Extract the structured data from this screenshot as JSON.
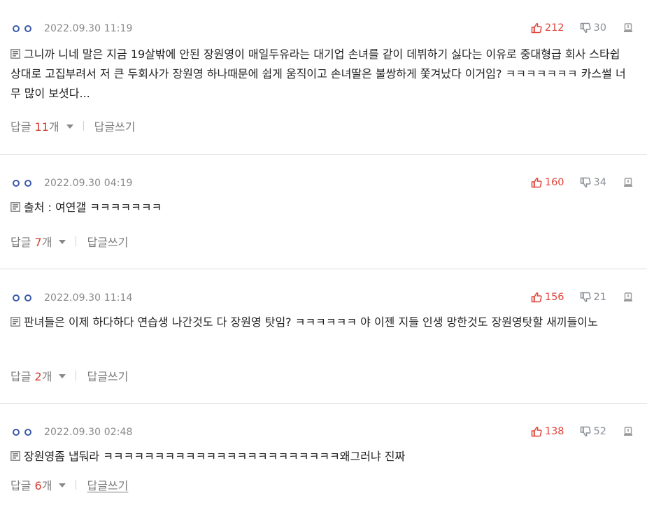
{
  "comments": [
    {
      "date": "2022.09.30 11:19",
      "upvotes": "212",
      "downvotes": "30",
      "text": "그니까 니네 말은 지금 19살밖에 안된 장원영이 매일두유라는 대기업 손녀를 같이 데뷔하기 싫다는 이유로 중대형급 회사 스타쉽 상대로 고집부려서 저 큰 두회사가 장원영 하나때문에 쉽게 움직이고 손녀딸은 불쌍하게 쫓겨났다 이거임? ㅋㅋㅋㅋㅋㅋㅋ 카스썰 너무 많이 보셧다...",
      "reply_label": "답글",
      "reply_count": "11",
      "reply_unit": "개",
      "write_label": "답글쓰기"
    },
    {
      "date": "2022.09.30 04:19",
      "upvotes": "160",
      "downvotes": "34",
      "text": "출처 : 여연갤 ㅋㅋㅋㅋㅋㅋㅋ",
      "reply_label": "답글",
      "reply_count": "7",
      "reply_unit": "개",
      "write_label": "답글쓰기"
    },
    {
      "date": "2022.09.30 11:14",
      "upvotes": "156",
      "downvotes": "21",
      "text": "판녀들은 이제 하다하다 연습생 나간것도 다 장원영 탓임? ㅋㅋㅋㅋㅋㅋ 야 이젠 지들 인생 망한것도 장원영탓할 새끼들이노",
      "reply_label": "답글",
      "reply_count": "2",
      "reply_unit": "개",
      "write_label": "답글쓰기"
    },
    {
      "date": "2022.09.30 02:48",
      "upvotes": "138",
      "downvotes": "52",
      "text": "장원영좀 냅둬라 ㅋㅋㅋㅋㅋㅋㅋㅋㅋㅋㅋㅋㅋㅋㅋㅋㅋㅋㅋㅋㅋㅋㅋ왜그러냐 진짜",
      "reply_label": "답글",
      "reply_count": "6",
      "reply_unit": "개",
      "write_label": "답글쓰기"
    }
  ],
  "icons": {
    "user": "user-dots-icon",
    "upvote": "thumbs-up-icon",
    "downvote": "thumbs-down-icon",
    "report": "report-icon",
    "memo": "memo-icon",
    "expand": "chevron-down-icon"
  },
  "colors": {
    "accent_red": "#e0443a",
    "user_blue": "#3c5aa8",
    "muted": "#8a8a8a"
  }
}
